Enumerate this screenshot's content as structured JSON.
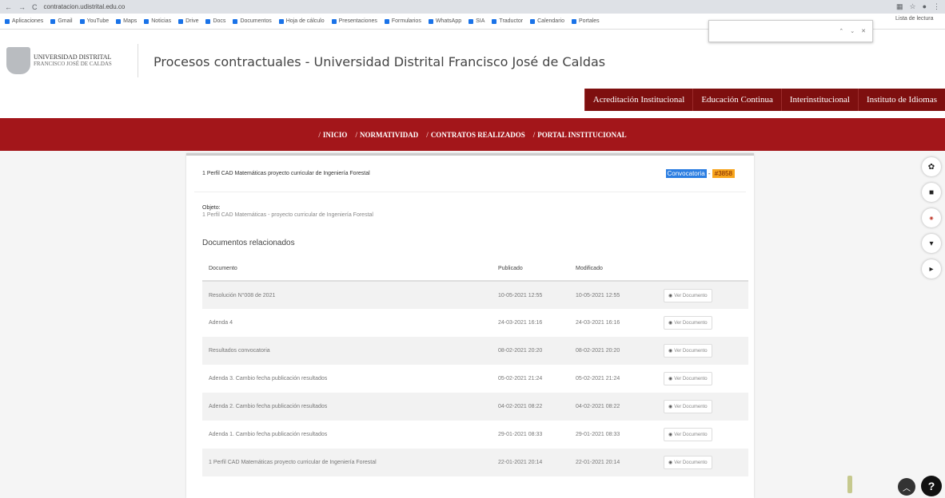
{
  "browser": {
    "url": "contratacion.udistrital.edu.co",
    "bookmarks": [
      "Aplicaciones",
      "Gmail",
      "YouTube",
      "Maps",
      "Noticias",
      "Drive",
      "Docs",
      "Documentos",
      "Hoja de cálculo",
      "Presentaciones",
      "Formularios",
      "WhatsApp",
      "SIA",
      "Traductor",
      "Calendario",
      "Portales"
    ],
    "reading_list": "Lista de lectura"
  },
  "site": {
    "logo_line1": "UNIVERSIDAD DISTRITAL",
    "logo_line2": "FRANCISCO JOSÉ DE CALDAS",
    "title": "Procesos contractuales - Universidad Distrital Francisco José de Caldas",
    "topnav": [
      "Acreditación Institucional",
      "Educación Continua",
      "Interinstitucional",
      "Instituto de Idiomas"
    ],
    "mainnav": [
      "INICIO",
      "NORMATIVIDAD",
      "CONTRATOS REALIZADOS",
      "PORTAL INSTITUCIONAL"
    ]
  },
  "card": {
    "heading": "1 Perfil CAD Matemáticas proyecto curricular de Ingeniería Forestal",
    "convocatoria_label": "Convocatoria",
    "convocatoria_number": "#3858",
    "objeto_label": "Objeto:",
    "objeto_value": "1 Perfil CAD Matemáticas - proyecto curricular de Ingeniería Forestal",
    "docs_title": "Documentos relacionados",
    "columns": [
      "Documento",
      "Publicado",
      "Modificado",
      ""
    ],
    "view_label": "Ver Documento",
    "rows": [
      {
        "doc": "Resolución N°008 de 2021",
        "pub": "10-05-2021 12:55",
        "mod": "10-05-2021 12:55"
      },
      {
        "doc": "Adenda 4",
        "pub": "24-03-2021 16:16",
        "mod": "24-03-2021 16:16"
      },
      {
        "doc": "Resultados convocatoria",
        "pub": "08-02-2021 20:20",
        "mod": "08-02-2021 20:20"
      },
      {
        "doc": "Adenda 3. Cambio fecha publicación resultados",
        "pub": "05-02-2021 21:24",
        "mod": "05-02-2021 21:24"
      },
      {
        "doc": "Adenda 2. Cambio fecha publicación resultados",
        "pub": "04-02-2021 08:22",
        "mod": "04-02-2021 08:22"
      },
      {
        "doc": "Adenda 1. Cambio fecha publicación resultados",
        "pub": "29-01-2021 08:33",
        "mod": "29-01-2021 08:33"
      },
      {
        "doc": "1 Perfil CAD Matemáticas proyecto curricular de Ingeniería Forestal",
        "pub": "22-01-2021 20:14",
        "mod": "22-01-2021 20:14"
      }
    ]
  },
  "icons": {
    "settings": "gear-icon",
    "list": "list-icon",
    "seal": "seal-icon",
    "cart": "cart-icon",
    "play": "play-icon",
    "up": "chevron-up-icon",
    "help": "help-icon"
  }
}
